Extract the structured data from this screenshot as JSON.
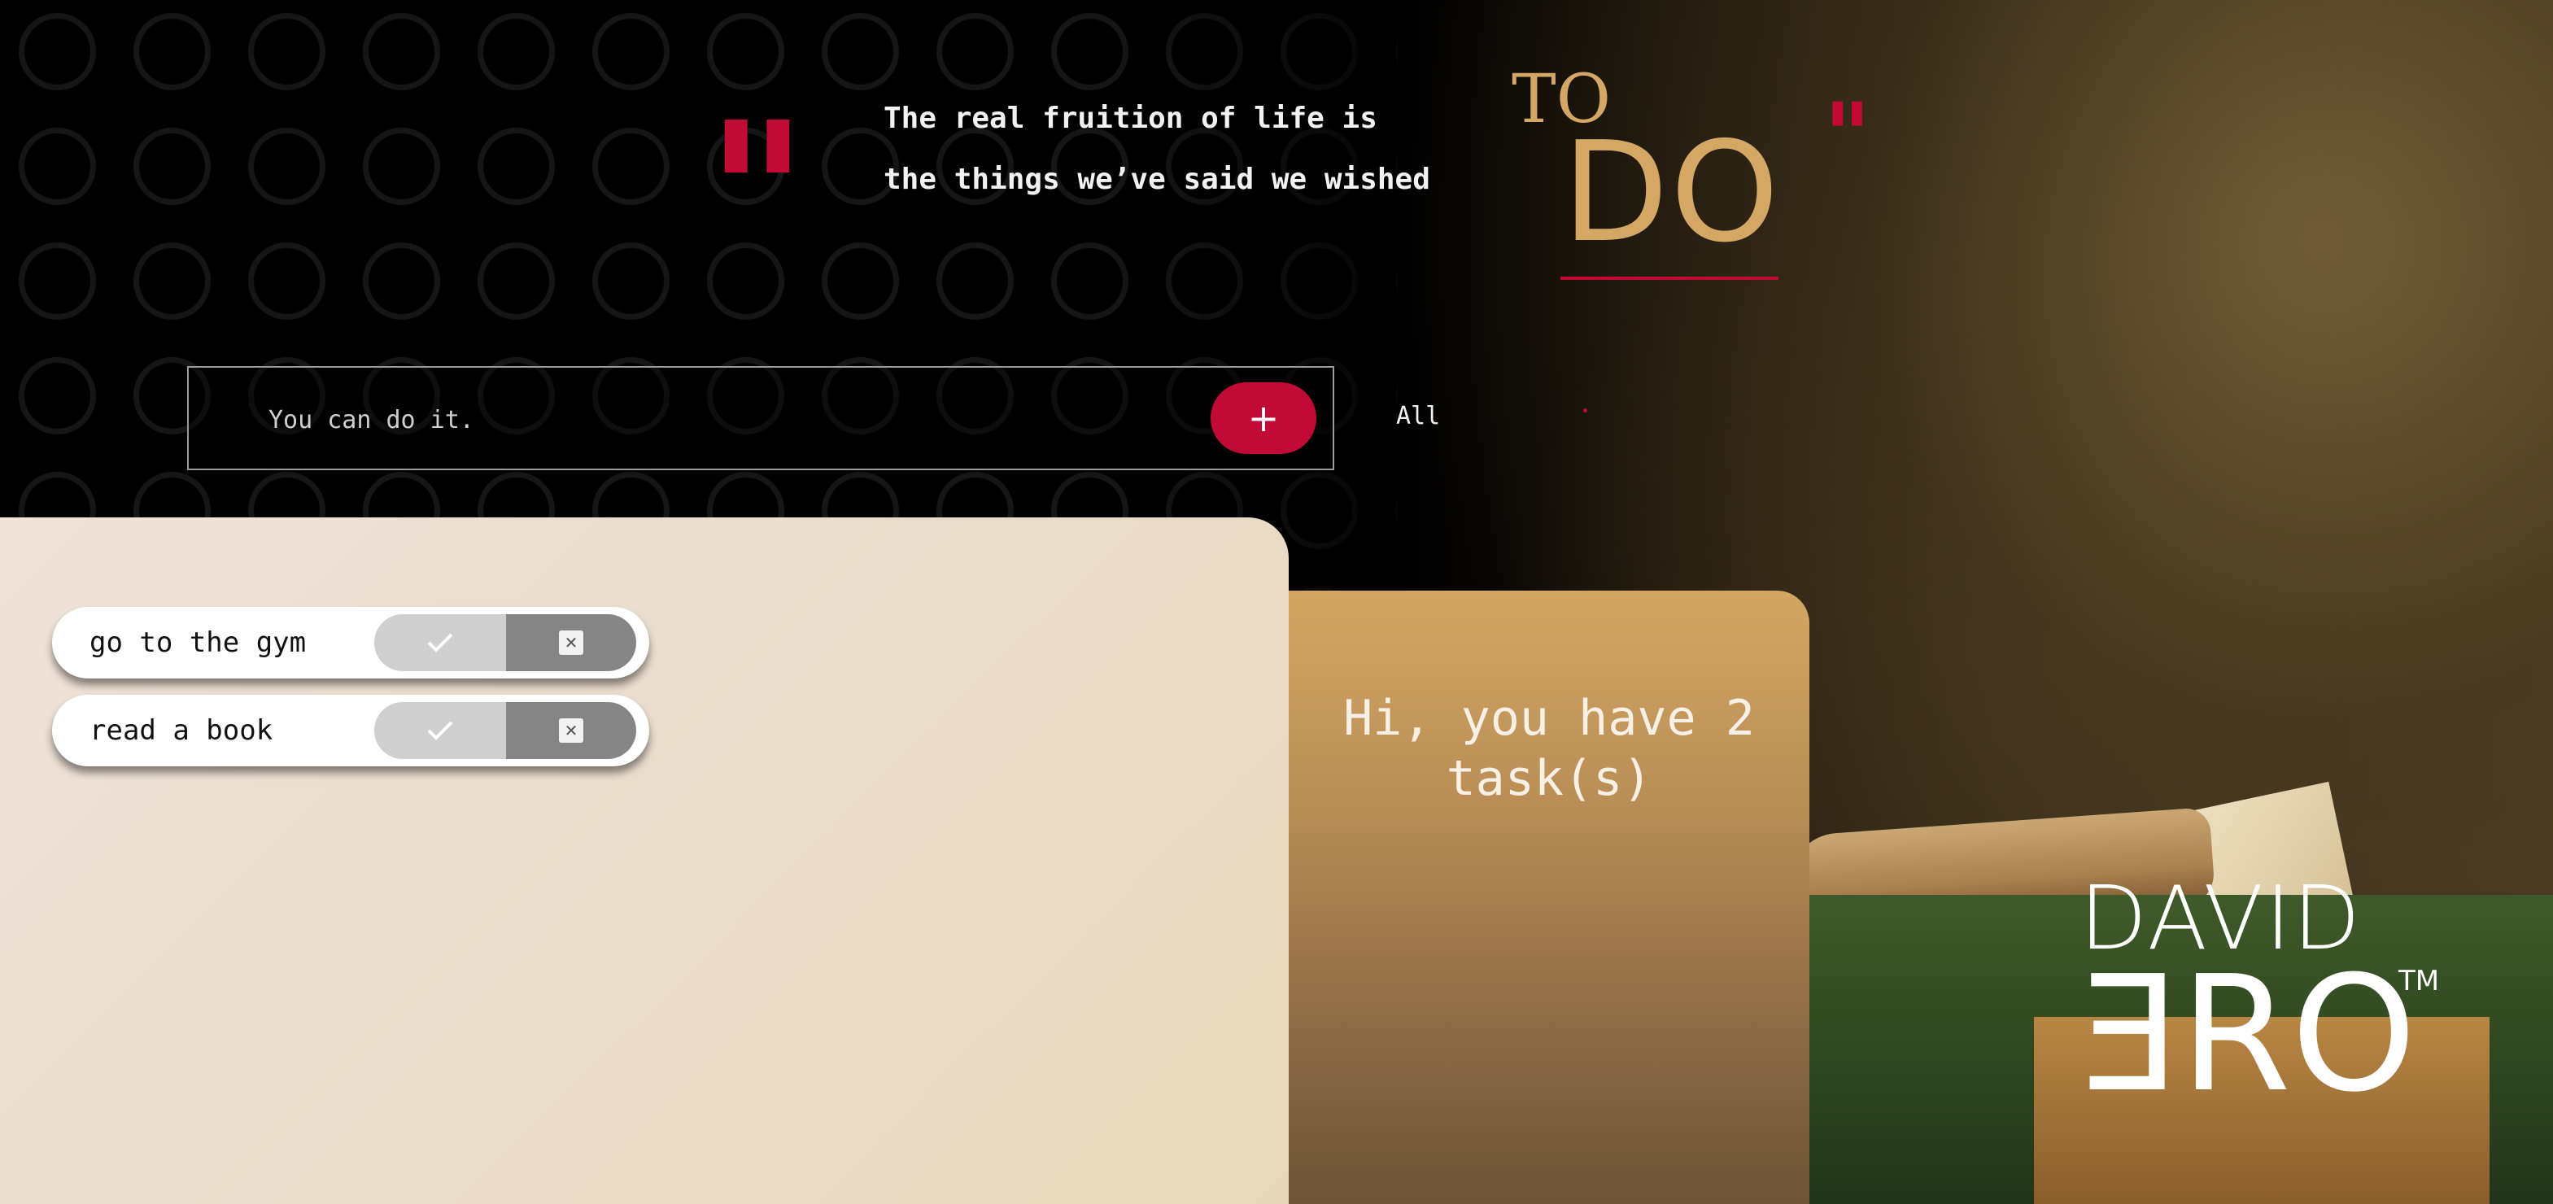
{
  "quote": {
    "open_mark": "\"",
    "line1": "The real fruition of life is",
    "line2": "the things we’ve said we wished",
    "close_mark": "\""
  },
  "title": {
    "small": "TO",
    "big": "DO"
  },
  "input": {
    "placeholder": "You can do it.",
    "value": "",
    "add_label": "+"
  },
  "filter": {
    "selected": "All"
  },
  "todos": [
    {
      "text": "go to the gym"
    },
    {
      "text": "read a book"
    }
  ],
  "greeting": {
    "line1": "Hi, you have 2",
    "line2": "task(s)"
  },
  "logo": {
    "top": "DAVID",
    "bottom": "ƎRO",
    "tm": "TM"
  },
  "colors": {
    "accent": "#c20a36",
    "gold": "#d4a765",
    "list_bg": "#efe3da",
    "side_bg": "#d4a663"
  }
}
